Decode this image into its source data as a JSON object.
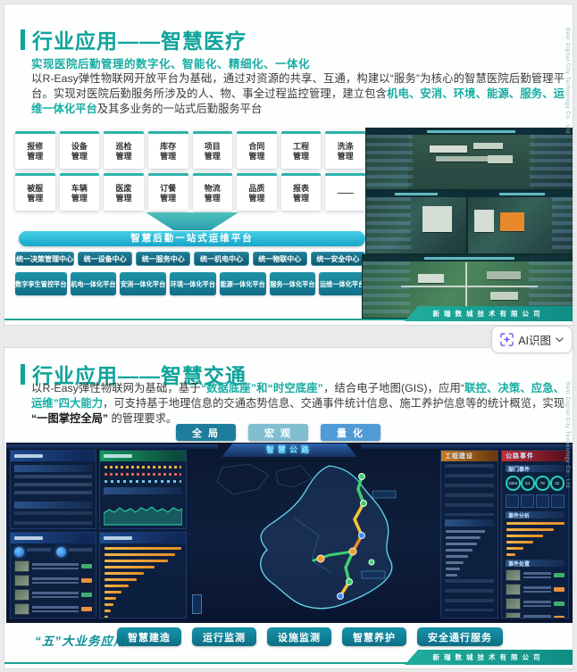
{
  "ai_tool": {
    "label": "AI识图"
  },
  "company_footer": "新瑞数城技术有限公司",
  "side_watermark": "Best Digital City Technology Co., Ltd",
  "colors": {
    "accent_teal": "#0ea39b",
    "highlight_teal": "#17ada3",
    "footer_teal": "#17a393",
    "ai_icon_purple": "#7a5cf5"
  },
  "slide1": {
    "title": "行业应用——智慧医疗",
    "subtitle": "实现医院后勤管理的数字化、智能化、精细化、一体化",
    "paragraph": [
      {
        "t": "以R-Easy弹性物联网开放平台为基础，通过对资源的共享、互通，构建以“服务”为核心的智慧医院后勤管理平台。实现对医院后勤服务所涉及的人、物、事全过程监控管理，建立包含",
        "s": ""
      },
      {
        "t": "机电、安消、环境、能源、服务、运维一体化平台",
        "s": "hl"
      },
      {
        "t": "及其多业务的一站式后勤服务平台",
        "s": ""
      }
    ],
    "modules_row1": [
      "报修管理",
      "设备管理",
      "巡检管理",
      "库存管理",
      "项目管理",
      "合同管理",
      "工程管理",
      "洗涤管理"
    ],
    "modules_row2": [
      "被服管理",
      "车辆管理",
      "医废管理",
      "订餐管理",
      "物流管理",
      "品质管理",
      "报表管理",
      "——"
    ],
    "banner": "智慧后勤一站式运维平台",
    "centers": [
      "统一决策管理中心",
      "统一设备中心",
      "统一服务中心",
      "统一机电中心",
      "统一物联中心",
      "统一安全中心"
    ],
    "platforms": [
      "数字孪生管控平台",
      "机电一体化平台",
      "安消一体化平台",
      "环境一体化平台",
      "能源一体化平台",
      "服务一体化平台",
      "运维一体化平台"
    ]
  },
  "slide2": {
    "title": "行业应用——智慧交通",
    "paragraph": [
      {
        "t": "以R-Easy弹性物联网为基础，基于",
        "s": ""
      },
      {
        "t": "“数据底座”和“时空底座”",
        "s": "hl"
      },
      {
        "t": "，结合电子地图(GIS)，应用“",
        "s": ""
      },
      {
        "t": "联控、决策、应急、运维”四大能力",
        "s": "hl"
      },
      {
        "t": "，可支持基于地理信息的交通态势信息、交通事件统计信息、施工养护信息等的统计概览，实现 ",
        "s": ""
      },
      {
        "t": "“一图掌控全局”",
        "s": "bd"
      },
      {
        "t": " 的管理要求。",
        "s": ""
      }
    ],
    "view_tabs": [
      {
        "label": "全 局",
        "color": "#1d7e9b"
      },
      {
        "label": "宏 观",
        "color": "#82bed1"
      },
      {
        "label": "量 化",
        "color": "#4f9bd8"
      }
    ],
    "dashboard": {
      "header": "智慧公路",
      "panel_construction": "工程建设",
      "panel_events": "公路事件",
      "sub_dept": "部门事件",
      "sub_analysis": "事件分析",
      "sub_handling": "事件处置",
      "gauges": [
        "4384",
        "54",
        "78",
        "22"
      ]
    },
    "biz_label": "“五”大业务应用",
    "biz_buttons": [
      "智慧建造",
      "运行监测",
      "设施监测",
      "智慧养护",
      "安全通行服务"
    ]
  }
}
